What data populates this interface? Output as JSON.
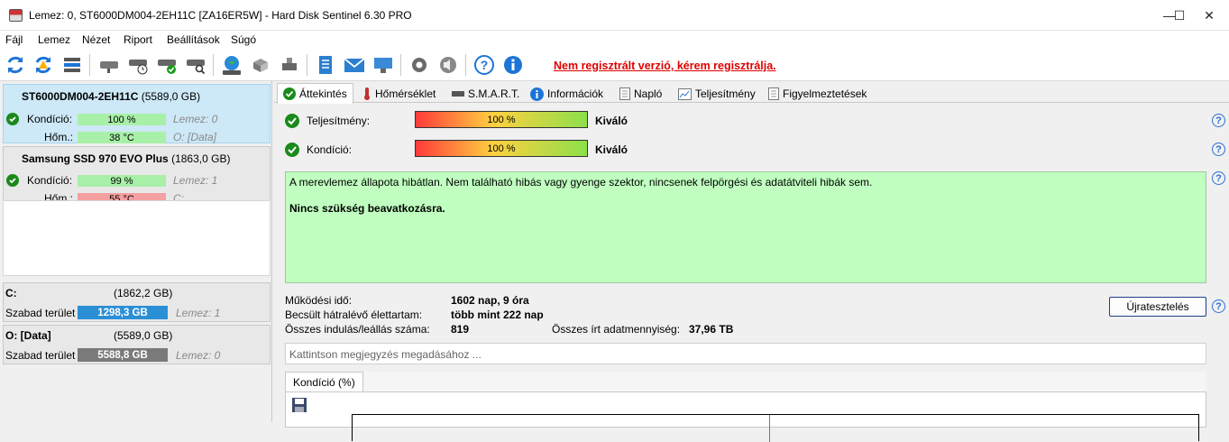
{
  "window": {
    "title": "Lemez: 0, ST6000DM004-2EH11C [ZA16ER5W]  -  Hard Disk Sentinel 6.30 PRO",
    "minimize_glyph": "—",
    "maximize_glyph": "☐",
    "close_glyph": "✕"
  },
  "menu": [
    "Fájl",
    "Lemez",
    "Nézet",
    "Riport",
    "Beállítások",
    "Súgó"
  ],
  "toolbar": {
    "icons": [
      "refresh-icon",
      "refresh-warning-icon",
      "disk-list-icon",
      "disk-icon",
      "disk-clock-icon",
      "disk-check-icon",
      "disk-search-icon",
      "globe-icon",
      "network-disk-icon",
      "network-disk-2-icon",
      "report-icon",
      "mail-icon",
      "network-upload-icon",
      "settings-icon",
      "sound-icon",
      "help-icon",
      "info-icon"
    ],
    "registration_text": "Nem regisztrált verzió, kérem regisztrálja."
  },
  "disks": [
    {
      "name": "ST6000DM004-2EH11C",
      "size": "(5589,0 GB)",
      "condition_label": "Kondíció:",
      "condition_value": "100 %",
      "condition_fraction": 1.0,
      "temp_label": "Hőm.:",
      "temp_value": "38 °C",
      "disk_label": "Lemez: 0",
      "volume_label": "O: [Data]"
    },
    {
      "name": "Samsung SSD 970 EVO Plus",
      "size": "(1863,0 GB)",
      "condition_label": "Kondíció:",
      "condition_value": "99 %",
      "condition_fraction": 0.99,
      "temp_label": "Hőm.:",
      "temp_value": "55 °C",
      "disk_label": "Lemez: 1",
      "volume_label": "C:"
    }
  ],
  "volumes": [
    {
      "name": "C:",
      "size": "(1862,2 GB)",
      "free_label": "Szabad terület",
      "free_value": "1298,3 GB",
      "disk": "Lemez: 1",
      "color": "#2b8fd6"
    },
    {
      "name": "O: [Data]",
      "size": "(5589,0 GB)",
      "free_label": "Szabad terület",
      "free_value": "5588,8 GB",
      "disk": "Lemez: 0",
      "color": "#7a7a7a"
    }
  ],
  "tabs": [
    "Áttekintés",
    "Hőmérséklet",
    "S.M.A.R.T.",
    "Információk",
    "Napló",
    "Teljesítmény",
    "Figyelmeztetések"
  ],
  "overview": {
    "performance_label": "Teljesítmény:",
    "performance_value": "100 %",
    "performance_rating": "Kiváló",
    "condition_label": "Kondíció:",
    "condition_value": "100 %",
    "condition_rating": "Kiváló",
    "status_text": "A merevlemez állapota hibátlan. Nem található hibás vagy gyenge szektor, nincsenek felpörgési és adatátviteli hibák sem.",
    "action_text": "Nincs szükség beavatkozásra.",
    "stats": {
      "uptime_label": "Működési idő:",
      "uptime_value": "1602 nap, 9 óra",
      "lifetime_label": "Becsült hátralévő élettartam:",
      "lifetime_value": "több mint 222 nap",
      "startstop_label": "Összes indulás/leállás száma:",
      "startstop_value": "819",
      "written_label": "Összes írt adatmennyiség:",
      "written_value": "37,96 TB"
    },
    "retest_button": "Újratesztelés",
    "note_placeholder": "Kattintson megjegyzés megadásához ...",
    "chart_tab": "Kondíció  (%)",
    "help_glyph": "?"
  }
}
